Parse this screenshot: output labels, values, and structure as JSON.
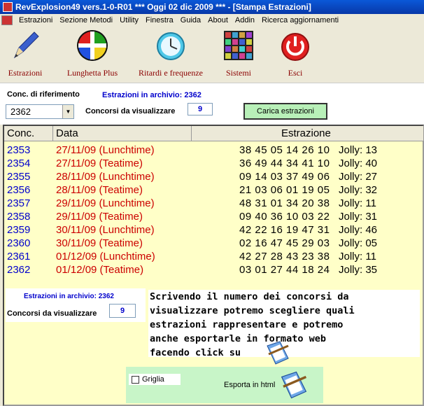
{
  "titlebar": {
    "title": "RevExplosion49 vers.1-0-R01   ***   Oggi 02 dic 2009   ***   - [Stampa Estrazioni]"
  },
  "menu": [
    "Estrazioni",
    "Sezione Metodi",
    "Utility",
    "Finestra",
    "Guida",
    "About",
    "Addin",
    "Ricerca aggiornamenti"
  ],
  "toolbar": {
    "estrazioni": "Estrazioni",
    "lunghetta": "Lunghetta Plus",
    "ritardi": "Ritardi e frequenze",
    "sistemi": "Sistemi",
    "esci": "Esci"
  },
  "form": {
    "conc_rif_label": "Conc. di riferimento",
    "archivio_label": "Estrazioni in archivio: 2362",
    "conc_value": "2362",
    "da_visualizzare_label": "Concorsi da visualizzare",
    "da_visualizzare_value": "9",
    "carica_button": "Carica estrazioni"
  },
  "table": {
    "headers": [
      "Conc.",
      "Data",
      "Estrazione"
    ],
    "rows": [
      {
        "conc": "2353",
        "data": "27/11/09  (Lunchtime)",
        "numeri": "38 45 05 14 26 10",
        "jolly": "Jolly: 13"
      },
      {
        "conc": "2354",
        "data": "27/11/09  (Teatime)",
        "numeri": "36 49 44 34 41 10",
        "jolly": "Jolly: 40"
      },
      {
        "conc": "2355",
        "data": "28/11/09  (Lunchtime)",
        "numeri": "09 14 03 37 49 06",
        "jolly": "Jolly: 27"
      },
      {
        "conc": "2356",
        "data": "28/11/09  (Teatime)",
        "numeri": "21 03 06 01 19 05",
        "jolly": "Jolly: 32"
      },
      {
        "conc": "2357",
        "data": "29/11/09  (Lunchtime)",
        "numeri": "48 31 01 34 20 38",
        "jolly": "Jolly: 11"
      },
      {
        "conc": "2358",
        "data": "29/11/09  (Teatime)",
        "numeri": "09 40 36 10 03 22",
        "jolly": "Jolly: 31"
      },
      {
        "conc": "2359",
        "data": "30/11/09  (Lunchtime)",
        "numeri": "42 22 16 19 47 31",
        "jolly": "Jolly: 46"
      },
      {
        "conc": "2360",
        "data": "30/11/09  (Teatime)",
        "numeri": "02 16 47 45 29 03",
        "jolly": "Jolly: 05"
      },
      {
        "conc": "2361",
        "data": "01/12/09  (Lunchtime)",
        "numeri": "42 27 28 43 23 38",
        "jolly": "Jolly: 11"
      },
      {
        "conc": "2362",
        "data": "01/12/09  (Teatime)",
        "numeri": "03 01 27 44 18 24",
        "jolly": "Jolly: 35"
      }
    ]
  },
  "lower": {
    "archivio_label": "Estrazioni in archivio: 2362",
    "da_visualizzare_label": "Concorsi da visualizzare",
    "da_visualizzare_value": "9",
    "note_lines": [
      "Scrivendo il numero dei concorsi da",
      "visualizzare potremo scegliere quali",
      "estrazioni rappresentare e potremo",
      "anche esportarle in formato web",
      "facendo click su"
    ],
    "griglia_label": "Griglia",
    "esporta_label": "Esporta in html"
  },
  "colors": {
    "accent_blue": "#0000cc",
    "date_red": "#cc0000",
    "grid_bg": "#ffffc8",
    "button_green": "#b8f0b8"
  }
}
